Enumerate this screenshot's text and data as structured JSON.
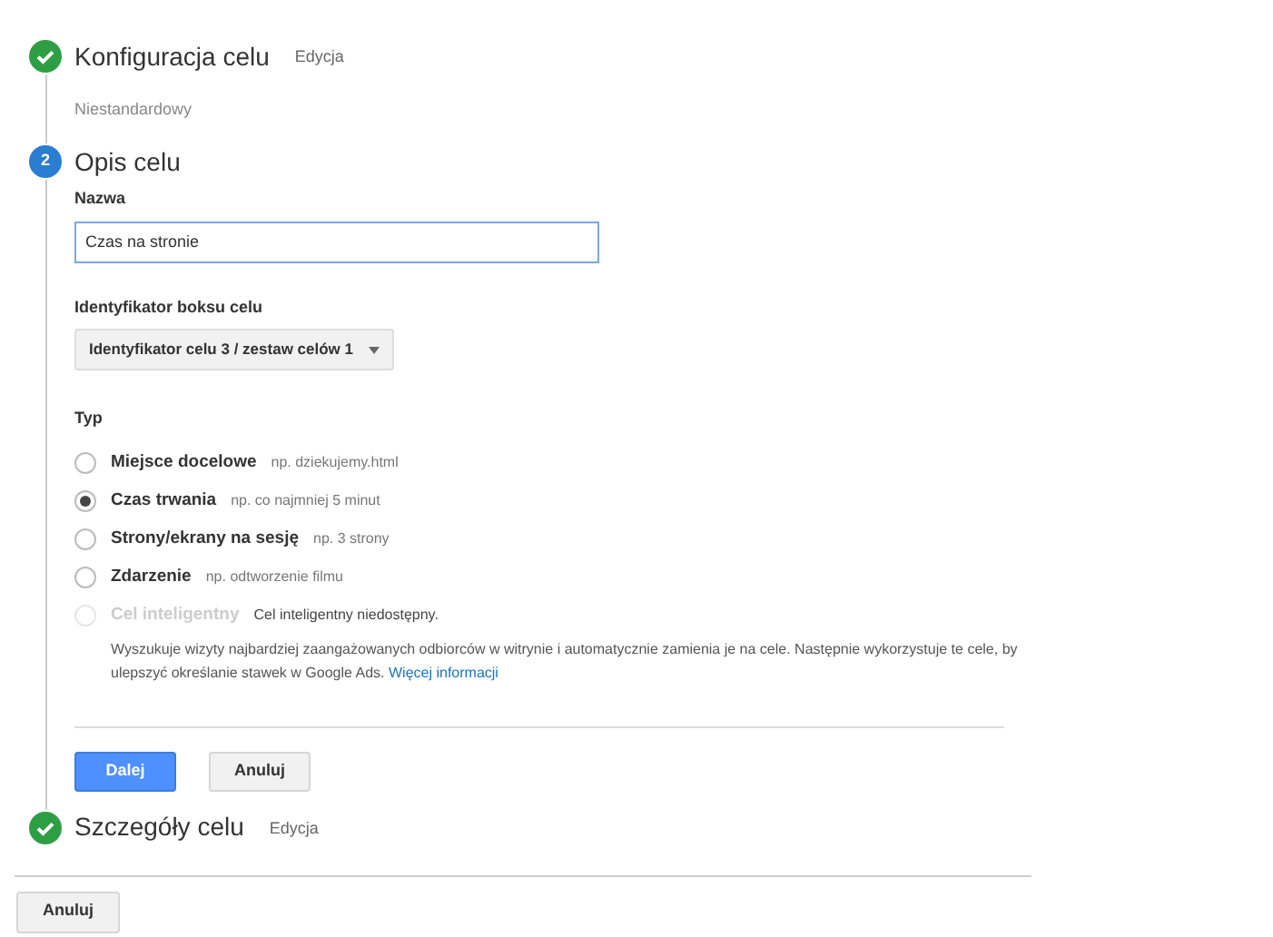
{
  "steps": [
    {
      "kind": "done",
      "title": "Konfiguracja celu",
      "edit_link": "Edycja",
      "summary": "Niestandardowy"
    },
    {
      "kind": "number",
      "marker": "2",
      "title": "Opis celu"
    },
    {
      "kind": "done",
      "title": "Szczegóły celu",
      "edit_link": "Edycja"
    }
  ],
  "form": {
    "name_label": "Nazwa",
    "name_value": "Czas na stronie",
    "slot_label": "Identyfikator boksu celu",
    "slot_value": "Identyfikator celu 3 / zestaw celów 1",
    "type_label": "Typ",
    "types": [
      {
        "label": "Miejsce docelowe",
        "hint": "np. dziekujemy.html",
        "selected": false,
        "disabled": false
      },
      {
        "label": "Czas trwania",
        "hint": "np. co najmniej 5 minut",
        "selected": true,
        "disabled": false
      },
      {
        "label": "Strony/ekrany na sesję",
        "hint": "np. 3 strony",
        "selected": false,
        "disabled": false
      },
      {
        "label": "Zdarzenie",
        "hint": "np. odtworzenie filmu",
        "selected": false,
        "disabled": false
      },
      {
        "label": "Cel inteligentny",
        "hint": "Cel inteligentny niedostępny.",
        "selected": false,
        "disabled": true
      }
    ],
    "smart_description": "Wyszukuje wizyty najbardziej zaangażowanych odbiorców w witrynie i automatycznie zamienia je na cele. Następnie wykorzystuje te cele, by ulepszyć określanie stawek w Google Ads.",
    "learn_more": "Więcej informacji",
    "next_button": "Dalej",
    "cancel_button": "Anuluj"
  },
  "footer_cancel": "Anuluj"
}
